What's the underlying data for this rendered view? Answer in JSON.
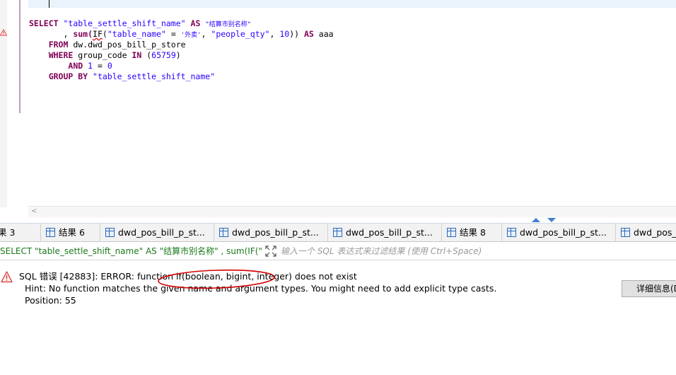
{
  "editor": {
    "lines": [
      [
        {
          "t": "SELECT",
          "c": "kw"
        },
        {
          "t": " "
        },
        {
          "t": "\"table_settle_shift_name\"",
          "c": "str"
        },
        {
          "t": " "
        },
        {
          "t": "AS",
          "c": "kw"
        },
        {
          "t": " "
        },
        {
          "t": "\"结算市别名称\"",
          "c": "str-cjk"
        }
      ],
      [
        {
          "t": "       , "
        },
        {
          "t": "sum(",
          "c": "kw"
        },
        {
          "t": "IF",
          "c": "squiggle"
        },
        {
          "t": "("
        },
        {
          "t": "\"table_name\"",
          "c": "str"
        },
        {
          "t": " = "
        },
        {
          "t": "'外卖'",
          "c": "str-cjk"
        },
        {
          "t": ", "
        },
        {
          "t": "\"people_qty\"",
          "c": "str"
        },
        {
          "t": ", "
        },
        {
          "t": "10",
          "c": "num"
        },
        {
          "t": ")) "
        },
        {
          "t": "AS",
          "c": "kw"
        },
        {
          "t": " aaa"
        }
      ],
      [
        {
          "t": "    "
        },
        {
          "t": "FROM",
          "c": "kw"
        },
        {
          "t": " dw.dwd_pos_bill_p_store"
        }
      ],
      [
        {
          "t": "    "
        },
        {
          "t": "WHERE",
          "c": "kw"
        },
        {
          "t": " group_code "
        },
        {
          "t": "IN",
          "c": "kw"
        },
        {
          "t": " ("
        },
        {
          "t": "65759",
          "c": "num"
        },
        {
          "t": ")"
        }
      ],
      [
        {
          "t": "        "
        },
        {
          "t": "AND",
          "c": "kw"
        },
        {
          "t": " "
        },
        {
          "t": "1",
          "c": "num"
        },
        {
          "t": " = "
        },
        {
          "t": "0",
          "c": "num"
        }
      ],
      [
        {
          "t": "    "
        },
        {
          "t": "GROUP BY",
          "c": "kw"
        },
        {
          "t": " "
        },
        {
          "t": "\"table_settle_shift_name\"",
          "c": "str"
        }
      ]
    ]
  },
  "tabs": [
    {
      "label": "果 3",
      "icon": "table-icon",
      "has_icon": false
    },
    {
      "label": "结果 6",
      "icon": "table-icon",
      "has_icon": true
    },
    {
      "label": "dwd_pos_bill_p_st...",
      "icon": "table-icon",
      "has_icon": true
    },
    {
      "label": "dwd_pos_bill_p_st...",
      "icon": "table-icon",
      "has_icon": true
    },
    {
      "label": "dwd_pos_bill_p_st...",
      "icon": "table-icon",
      "has_icon": true
    },
    {
      "label": "结果 8",
      "icon": "table-icon",
      "has_icon": true
    },
    {
      "label": "dwd_pos_bill_p_st...",
      "icon": "table-icon",
      "has_icon": true
    },
    {
      "label": "dwd_pos_b",
      "icon": "table-icon",
      "has_icon": true
    }
  ],
  "filter": {
    "query_text": "SELECT \"table_settle_shift_name\" AS \"结算市别名称\" , sum(IF(\"tab",
    "placeholder": "输入一个 SQL 表达式来过滤结果 (使用 Ctrl+Space)"
  },
  "error": {
    "title_prefix": "SQL 错误 [42883]: ERROR: function ",
    "title_highlight": "if(boolean, bigint, integer)",
    "title_suffix": " does not exist",
    "hint": "Hint: No function matches the given name and argument types. You might need to add explicit type casts.",
    "position": "Position: 55",
    "details_button": "详细信息(D"
  },
  "colors": {
    "keyword": "#7f0055",
    "string": "#2a00ff",
    "query_text": "#1b7a1b",
    "error_ellipse": "#d40000"
  }
}
